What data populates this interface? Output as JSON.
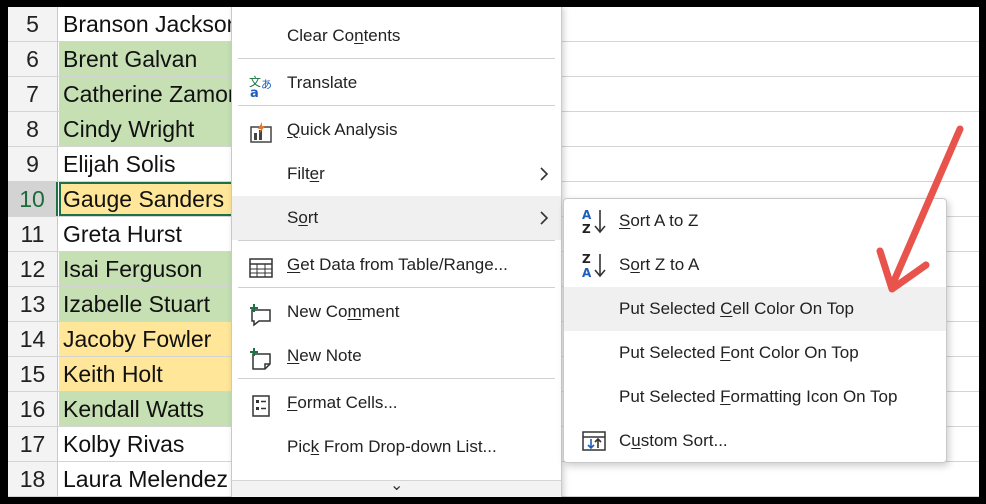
{
  "colors": {
    "green_fill": "#c6e0b4",
    "yellow_fill": "#ffe699",
    "accent": "#1e7145",
    "arrow": "#e8534b"
  },
  "rows": [
    {
      "num": "5",
      "name": "Branson Jackson",
      "fill": "#ffffff"
    },
    {
      "num": "6",
      "name": "Brent Galvan",
      "fill": "#c6e0b4"
    },
    {
      "num": "7",
      "name": "Catherine Zamora",
      "fill": "#c6e0b4"
    },
    {
      "num": "8",
      "name": "Cindy Wright",
      "fill": "#c6e0b4"
    },
    {
      "num": "9",
      "name": "Elijah Solis",
      "fill": "#ffffff"
    },
    {
      "num": "10",
      "name": "Gauge Sanders",
      "fill": "#ffe699",
      "active": true
    },
    {
      "num": "11",
      "name": "Greta Hurst",
      "fill": "#ffffff"
    },
    {
      "num": "12",
      "name": "Isai Ferguson",
      "fill": "#c6e0b4"
    },
    {
      "num": "13",
      "name": "Izabelle Stuart",
      "fill": "#c6e0b4"
    },
    {
      "num": "14",
      "name": "Jacoby Fowler",
      "fill": "#ffe699"
    },
    {
      "num": "15",
      "name": "Keith Holt",
      "fill": "#ffe699"
    },
    {
      "num": "16",
      "name": "Kendall Watts",
      "fill": "#c6e0b4"
    },
    {
      "num": "17",
      "name": "Kolby Rivas",
      "fill": "#ffffff"
    },
    {
      "num": "18",
      "name": "Laura Melendez",
      "fill": "#ffffff"
    }
  ],
  "context_menu": {
    "items": [
      {
        "pre": "Clear Co",
        "key": "n",
        "post": "tents",
        "icon": "none"
      },
      {
        "pre": "Translate",
        "key": "",
        "post": "",
        "icon": "translate-icon"
      },
      {
        "pre": "",
        "key": "Q",
        "post": "uick Analysis",
        "icon": "quick-analysis-icon"
      },
      {
        "pre": "Filt",
        "key": "e",
        "post": "r",
        "icon": "none",
        "submenu": true
      },
      {
        "pre": "S",
        "key": "o",
        "post": "rt",
        "icon": "none",
        "submenu": true,
        "highlighted": true
      },
      {
        "pre": "",
        "key": "G",
        "post": "et Data from Table/Range...",
        "icon": "table-icon"
      },
      {
        "pre": "New Co",
        "key": "m",
        "post": "ment",
        "icon": "new-comment-icon"
      },
      {
        "pre": "",
        "key": "N",
        "post": "ew Note",
        "icon": "new-note-icon"
      },
      {
        "pre": "",
        "key": "F",
        "post": "ormat Cells...",
        "icon": "format-cells-icon"
      },
      {
        "pre": "Pic",
        "key": "k",
        "post": " From Drop-down List...",
        "icon": "none"
      }
    ],
    "scroll_glyph": "⌄"
  },
  "sort_submenu": {
    "items": [
      {
        "pre": "",
        "key": "S",
        "post": "ort A to Z",
        "icon": "sort-a-to-z-icon",
        "icon_top": "A",
        "icon_bottom": "Z"
      },
      {
        "pre": "S",
        "key": "o",
        "post": "rt Z to A",
        "icon": "sort-z-to-a-icon",
        "icon_top": "Z",
        "icon_bottom": "A"
      },
      {
        "pre": "Put Selected ",
        "key": "C",
        "post": "ell Color On Top",
        "icon": "none",
        "highlighted": true
      },
      {
        "pre": "Put Selected ",
        "key": "F",
        "post": "ont Color On Top",
        "icon": "none"
      },
      {
        "pre": "Put Selected ",
        "key": "F",
        "post": "ormatting Icon On Top",
        "icon": "none"
      },
      {
        "pre": "C",
        "key": "u",
        "post": "stom Sort...",
        "icon": "custom-sort-icon"
      }
    ]
  }
}
